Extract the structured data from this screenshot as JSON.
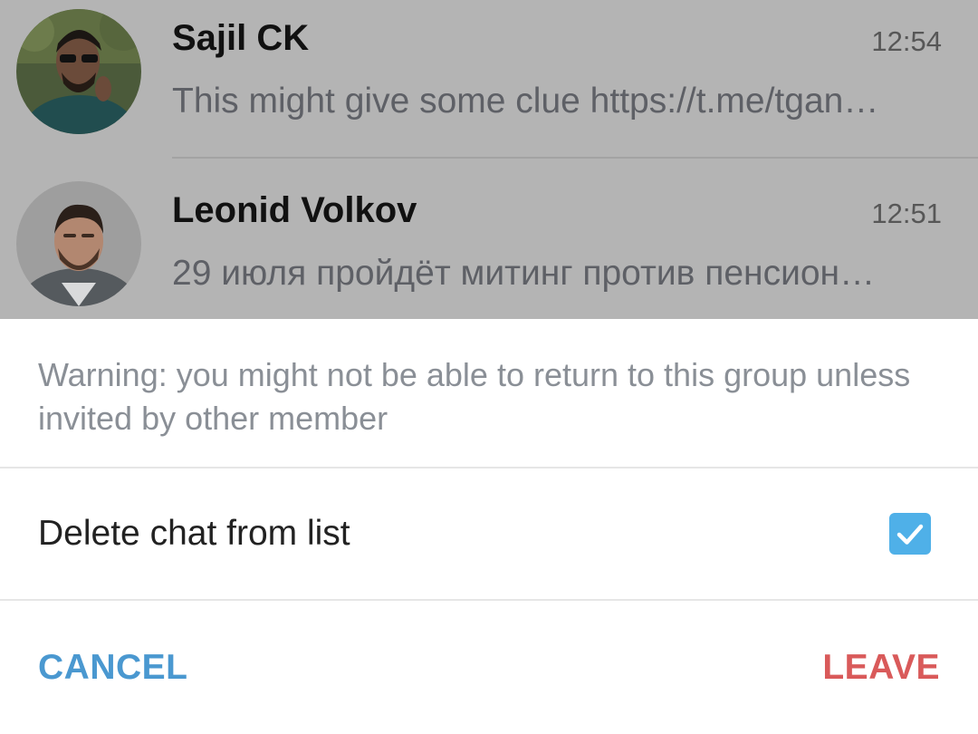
{
  "chats": [
    {
      "name": "Sajil CK",
      "time": "12:54",
      "preview": "This might give some clue https://t.me/tgan…"
    },
    {
      "name": "Leonid Volkov",
      "time": "12:51",
      "preview": "29 июля пройдёт митинг против пенсион…"
    }
  ],
  "dialog": {
    "warning": "Warning: you might not be able to return to this group unless invited by other member",
    "option_label": "Delete chat from list",
    "option_checked": true,
    "cancel_label": "CANCEL",
    "leave_label": "LEAVE"
  },
  "colors": {
    "dim_overlay": "#b4b4b4",
    "accent": "#4a98d0",
    "checkbox": "#4fb0e8",
    "danger": "#d95a5a",
    "warning_text": "#8a8f96"
  }
}
